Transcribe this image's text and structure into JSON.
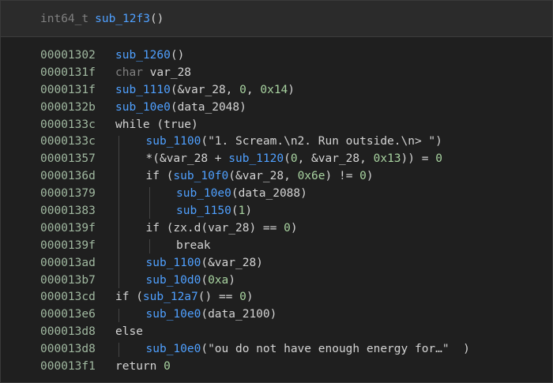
{
  "header": {
    "return_type": "int64_t",
    "function_name": "sub_12f3",
    "parens": "()"
  },
  "lines": [
    {
      "addr": "00001302",
      "indent": 0,
      "tokens": [
        [
          "fn",
          "sub_1260"
        ],
        [
          "op",
          "()"
        ]
      ]
    },
    {
      "addr": "0000131f",
      "indent": 0,
      "tokens": [
        [
          "type",
          "char"
        ],
        [
          "op",
          " var_28"
        ]
      ]
    },
    {
      "addr": "0000131f",
      "indent": 0,
      "tokens": [
        [
          "fn",
          "sub_1110"
        ],
        [
          "op",
          "(&var_28, "
        ],
        [
          "num",
          "0"
        ],
        [
          "op",
          ", "
        ],
        [
          "num",
          "0x14"
        ],
        [
          "op",
          ")"
        ]
      ]
    },
    {
      "addr": "0000132b",
      "indent": 0,
      "tokens": [
        [
          "fn",
          "sub_10e0"
        ],
        [
          "op",
          "(data_2048)"
        ]
      ]
    },
    {
      "addr": "0000133c",
      "indent": 0,
      "tokens": [
        [
          "kw",
          "while (true)"
        ]
      ]
    },
    {
      "addr": "0000133c",
      "indent": 1,
      "tokens": [
        [
          "fn",
          "sub_1100"
        ],
        [
          "str",
          "(\"1. Scream.\\n2. Run outside.\\n> \")"
        ]
      ]
    },
    {
      "addr": "00001357",
      "indent": 1,
      "tokens": [
        [
          "op",
          "*(&var_28 + "
        ],
        [
          "fn",
          "sub_1120"
        ],
        [
          "op",
          "("
        ],
        [
          "num",
          "0"
        ],
        [
          "op",
          ", &var_28, "
        ],
        [
          "num",
          "0x13"
        ],
        [
          "op",
          ")) = "
        ],
        [
          "num",
          "0"
        ]
      ]
    },
    {
      "addr": "0000136d",
      "indent": 1,
      "tokens": [
        [
          "kw",
          "if ("
        ],
        [
          "fn",
          "sub_10f0"
        ],
        [
          "op",
          "(&var_28, "
        ],
        [
          "num",
          "0x6e"
        ],
        [
          "op",
          ") != "
        ],
        [
          "num",
          "0"
        ],
        [
          "op",
          ")"
        ]
      ]
    },
    {
      "addr": "00001379",
      "indent": 2,
      "tokens": [
        [
          "fn",
          "sub_10e0"
        ],
        [
          "op",
          "(data_2088)"
        ]
      ]
    },
    {
      "addr": "00001383",
      "indent": 2,
      "tokens": [
        [
          "fn",
          "sub_1150"
        ],
        [
          "op",
          "("
        ],
        [
          "num",
          "1"
        ],
        [
          "op",
          ")"
        ]
      ]
    },
    {
      "addr": "0000139f",
      "indent": 1,
      "tokens": [
        [
          "kw",
          "if (zx.d(var_28) == "
        ],
        [
          "num",
          "0"
        ],
        [
          "op",
          ")"
        ]
      ]
    },
    {
      "addr": "0000139f",
      "indent": 2,
      "tokens": [
        [
          "kw",
          "break"
        ]
      ]
    },
    {
      "addr": "000013ad",
      "indent": 1,
      "tokens": [
        [
          "fn",
          "sub_1100"
        ],
        [
          "op",
          "(&var_28)"
        ]
      ]
    },
    {
      "addr": "000013b7",
      "indent": 1,
      "tokens": [
        [
          "fn",
          "sub_10d0"
        ],
        [
          "op",
          "("
        ],
        [
          "num",
          "0xa"
        ],
        [
          "op",
          ")"
        ]
      ]
    },
    {
      "addr": "000013cd",
      "indent": 0,
      "tokens": [
        [
          "kw",
          "if ("
        ],
        [
          "fn",
          "sub_12a7"
        ],
        [
          "op",
          "() == "
        ],
        [
          "num",
          "0"
        ],
        [
          "op",
          ")"
        ]
      ]
    },
    {
      "addr": "000013e6",
      "indent": 1,
      "tokens": [
        [
          "fn",
          "sub_10e0"
        ],
        [
          "op",
          "(data_2100)"
        ]
      ]
    },
    {
      "addr": "000013d8",
      "indent": 0,
      "tokens": [
        [
          "kw",
          "else"
        ]
      ]
    },
    {
      "addr": "000013d8",
      "indent": 1,
      "tokens": [
        [
          "fn",
          "sub_10e0"
        ],
        [
          "str",
          "(\"ou do not have enough energy for…\"  )"
        ]
      ]
    },
    {
      "addr": "000013f1",
      "indent": 0,
      "tokens": [
        [
          "kw",
          "return "
        ],
        [
          "num",
          "0"
        ]
      ]
    }
  ],
  "colors": {
    "background": "#1f1f1f",
    "header_background": "#2b2b2b",
    "function": "#4fa0ff",
    "number": "#a8d3a0",
    "address": "#a0b8a0",
    "text": "#d4d4d4",
    "type": "#808080"
  }
}
